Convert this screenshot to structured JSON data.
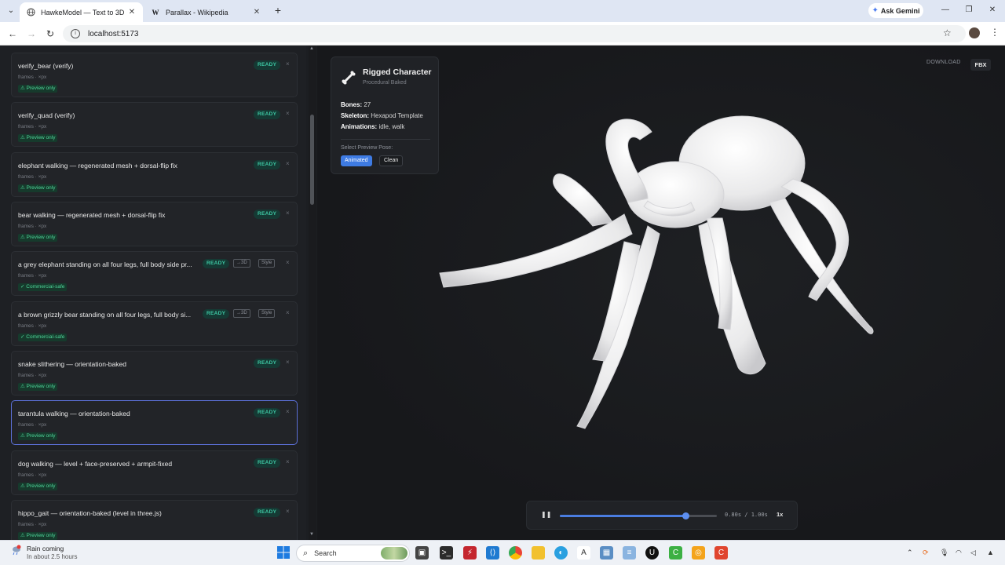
{
  "browser": {
    "tabs": [
      {
        "title": "HawkeModel — Text to 3D",
        "active": true
      },
      {
        "title": "Parallax - Wikipedia",
        "active": false
      }
    ],
    "ask_gemini": "Ask Gemini",
    "url": "localhost:5173"
  },
  "sidebar": {
    "items": [
      {
        "title": "verify_bear (verify)",
        "meta": "frames · ×px",
        "chip": "⚠ Preview only",
        "status": "READY"
      },
      {
        "title": "verify_quad (verify)",
        "meta": "frames · ×px",
        "chip": "⚠ Preview only",
        "status": "READY"
      },
      {
        "title": "elephant walking — regenerated mesh + dorsal-flip fix",
        "meta": "frames · ×px",
        "chip": "⚠ Preview only",
        "status": "READY"
      },
      {
        "title": "bear walking — regenerated mesh + dorsal-flip fix",
        "meta": "frames · ×px",
        "chip": "⚠ Preview only",
        "status": "READY"
      },
      {
        "title": "a grey elephant standing on all four legs, full body side pr...",
        "meta": "frames · ×px",
        "chip": "✓ Commercial-safe",
        "status": "READY",
        "tag1": "→3D",
        "tag2": "Style"
      },
      {
        "title": "a brown grizzly bear standing on all four legs, full body si...",
        "meta": "frames · ×px",
        "chip": "✓ Commercial-safe",
        "status": "READY",
        "tag1": "→3D",
        "tag2": "Style"
      },
      {
        "title": "snake slithering — orientation-baked",
        "meta": "frames · ×px",
        "chip": "⚠ Preview only",
        "status": "READY"
      },
      {
        "title": "tarantula walking — orientation-baked",
        "meta": "frames · ×px",
        "chip": "⚠ Preview only",
        "status": "READY",
        "selected": true
      },
      {
        "title": "dog walking — level + face-preserved + armpit-fixed",
        "meta": "frames · ×px",
        "chip": "⚠ Preview only",
        "status": "READY"
      },
      {
        "title": "hippo_gait — orientation-baked (level in three.js)",
        "meta": "frames · ×px",
        "chip": "⚠ Preview only",
        "status": "READY"
      }
    ],
    "close_glyph": "×"
  },
  "rig": {
    "title": "Rigged Character",
    "subtitle": "Procedural Baked",
    "bones_label": "Bones:",
    "bones_value": "27",
    "skeleton_label": "Skeleton:",
    "skeleton_value": "Hexapod Template",
    "animations_label": "Animations:",
    "animations_value": "idle, walk",
    "pose_label": "Select Preview Pose:",
    "pose_animated": "Animated",
    "pose_clean": "Clean"
  },
  "download": {
    "label": "DOWNLOAD",
    "format": "FBX"
  },
  "player": {
    "time": "0.80s / 1.00s",
    "progress": 0.8,
    "speed": "1x"
  },
  "taskbar": {
    "weather_title": "Rain coming",
    "weather_sub": "In about 2.5 hours",
    "search_placeholder": "Search"
  },
  "colors": {
    "accent": "#3e7be3",
    "ready": "#3ec9a5",
    "selected_border": "#5b6fd6"
  }
}
